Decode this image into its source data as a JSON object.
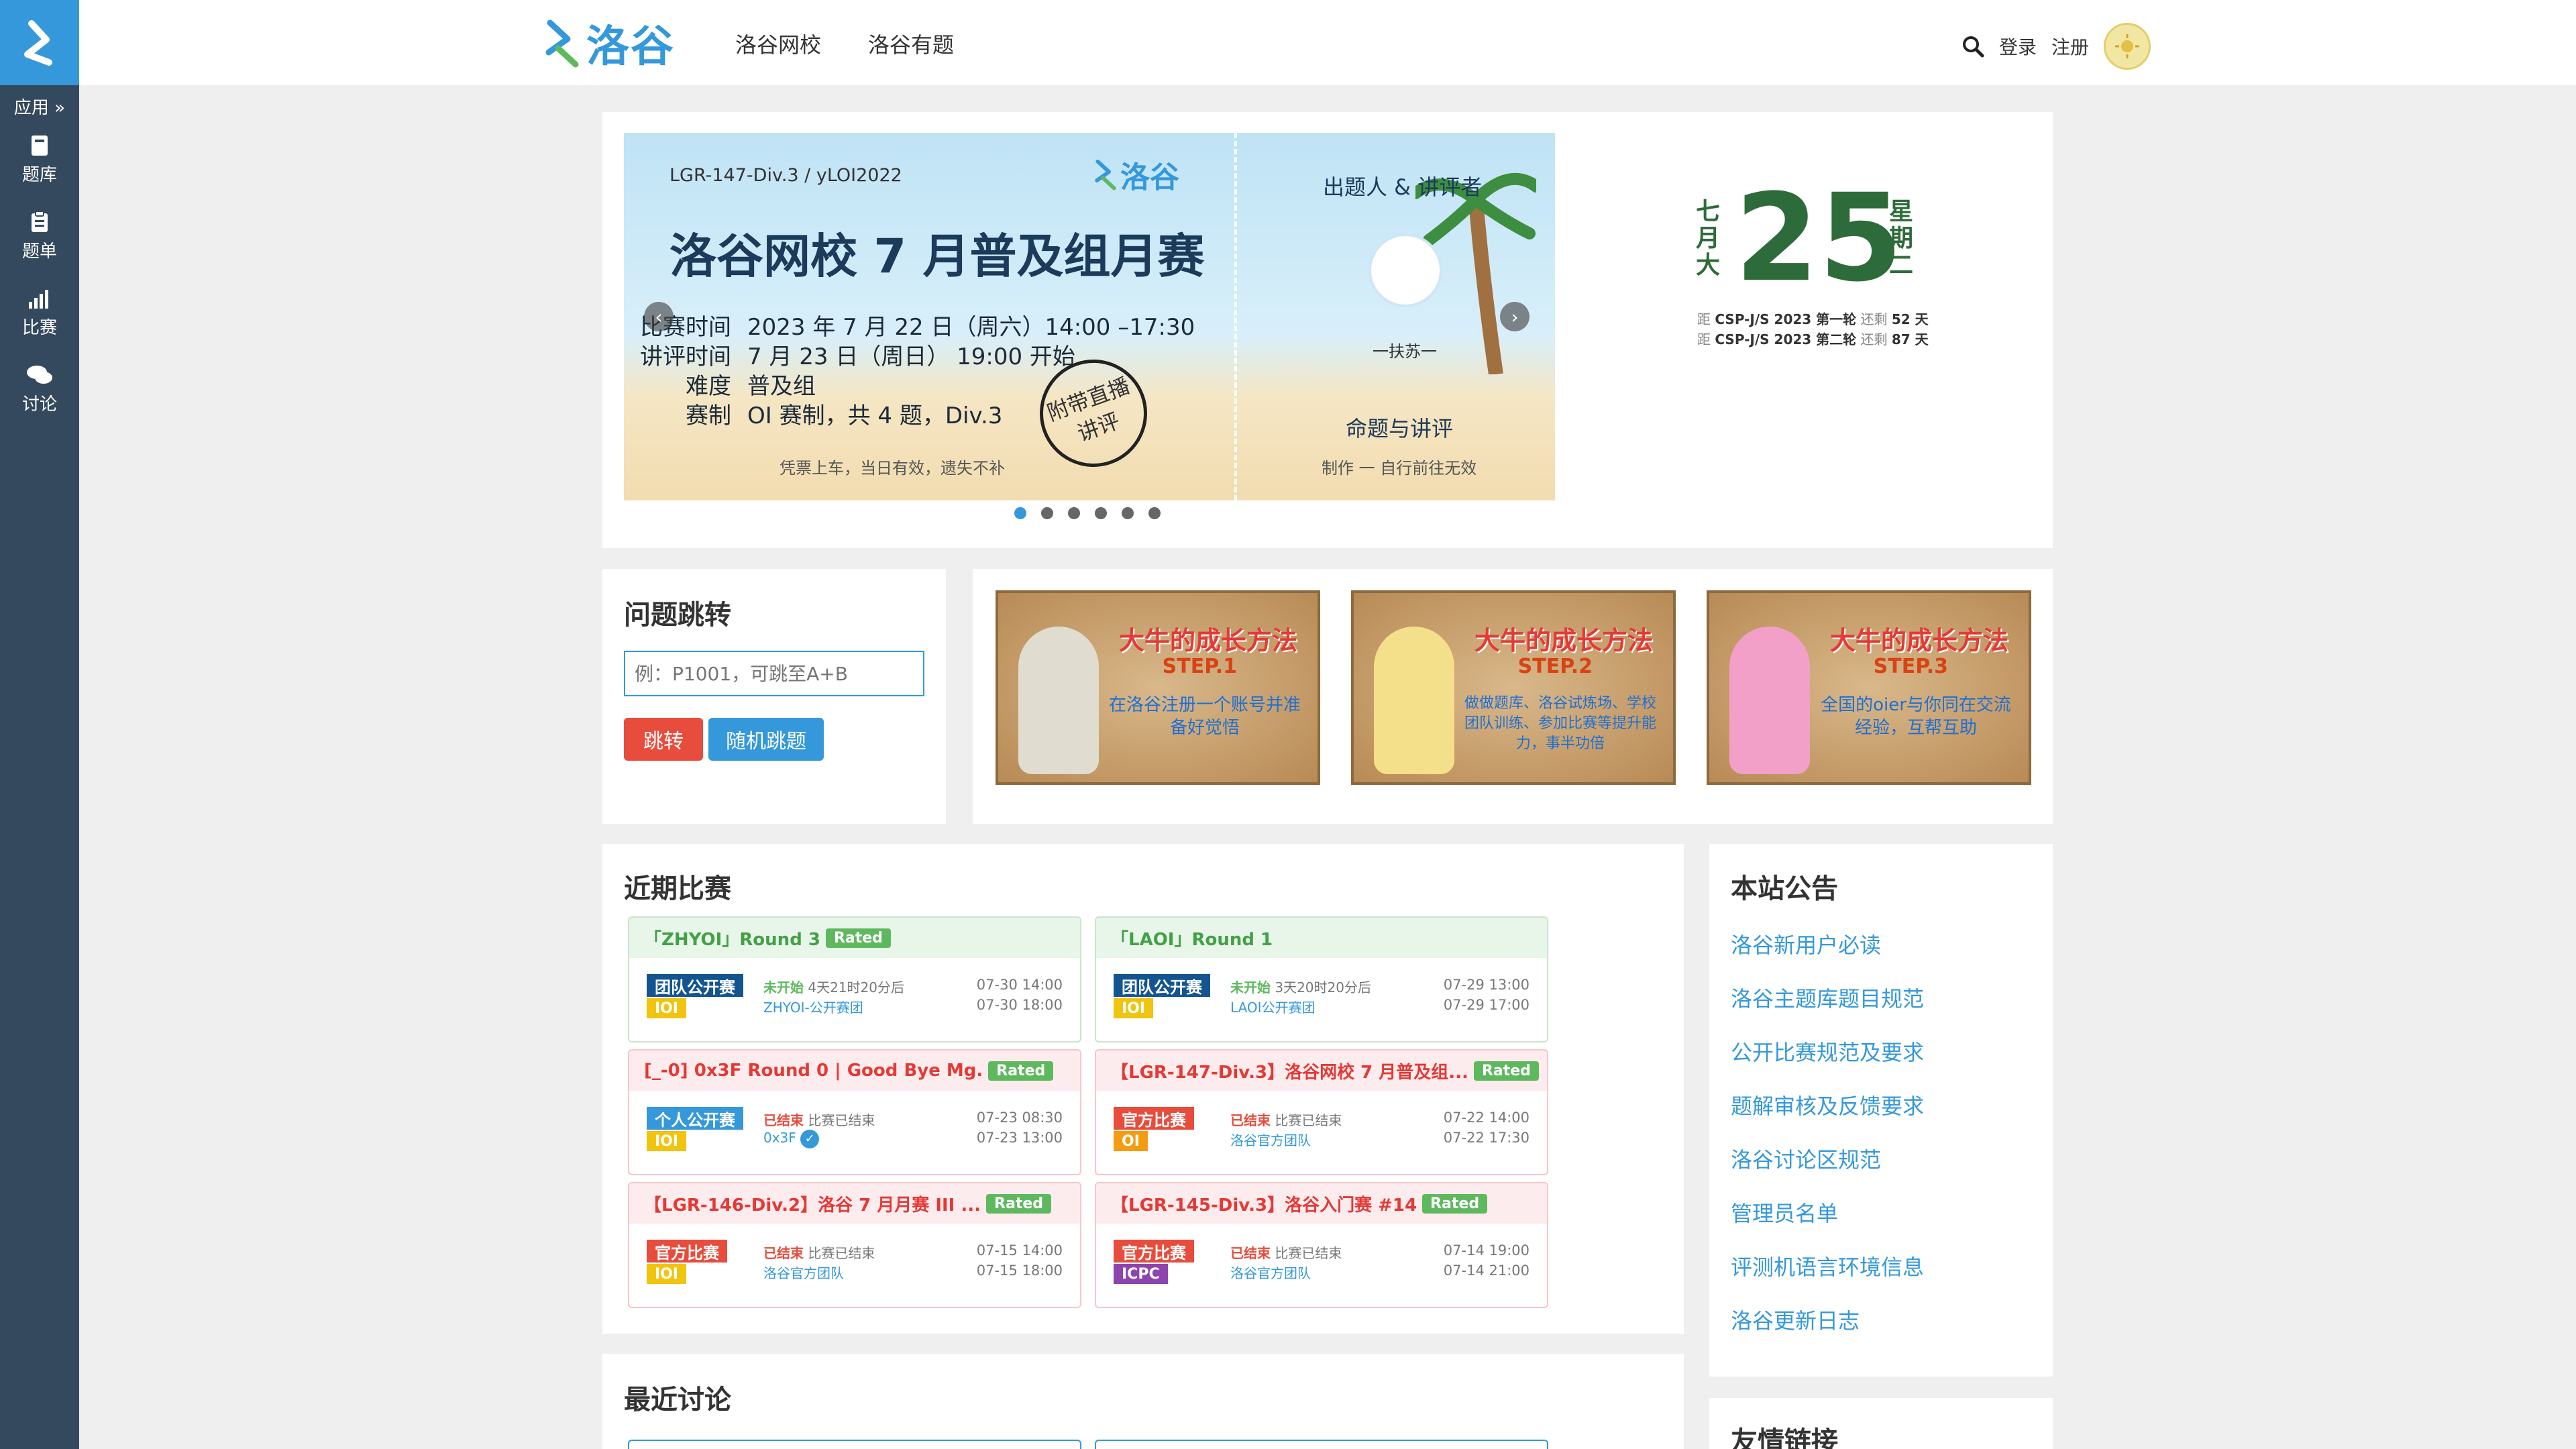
{
  "sidebar": {
    "apps_label": "应用",
    "items": [
      {
        "label": "题库",
        "icon": "book-icon"
      },
      {
        "label": "题单",
        "icon": "clipboard-icon"
      },
      {
        "label": "比赛",
        "icon": "bar-chart-icon"
      },
      {
        "label": "讨论",
        "icon": "comments-icon"
      }
    ]
  },
  "header": {
    "brand": "洛谷",
    "nav": [
      "洛谷网校",
      "洛谷有题"
    ],
    "login": "登录",
    "register": "注册"
  },
  "banner": {
    "tag": "LGR-147-Div.3 /  yLOI2022",
    "logo": "洛谷",
    "title": "洛谷网校 7 月普及组月赛",
    "rows": [
      {
        "k": "比赛时间",
        "v": "2023 年 7 月 22 日（周六）14:00 –17:30"
      },
      {
        "k": "讲评时间",
        "v": "7 月 23 日（周日） 19:00 开始"
      },
      {
        "k": "难度",
        "v": "普及组"
      },
      {
        "k": "赛制",
        "v": "OI 赛制，共 4 题，Div.3"
      }
    ],
    "stamp": "附带直播讲评",
    "footer": "凭票上车，当日有效，遗失不补",
    "right_title": "出题人 & 讲评者",
    "right_name": "一扶苏一",
    "right_sub": "命题与讲评",
    "right_footer": "制作 一  自行前往无效",
    "dot_count": 6,
    "active_dot": 0
  },
  "date": {
    "month": "七月大",
    "day": "25",
    "weekday": "星期二",
    "countdowns": [
      {
        "prefix": "距",
        "event": "CSP-J/S 2023 第一轮",
        "mid": "还剩",
        "days": "52 天"
      },
      {
        "prefix": "距",
        "event": "CSP-J/S 2023 第二轮",
        "mid": "还剩",
        "days": "87 天"
      }
    ]
  },
  "jump": {
    "title": "问题跳转",
    "placeholder": "例：P1001，可跳至A+B",
    "jump_btn": "跳转",
    "random_btn": "随机跳题"
  },
  "tutorials": [
    {
      "t1": "大牛的成长方法",
      "t2": "STEP.1",
      "t3": "在洛谷注册一个账号并准备好觉悟"
    },
    {
      "t1": "大牛的成长方法",
      "t2": "STEP.2",
      "t3": "做做题库、洛谷试炼场、学校团队训练、参加比赛等提升能力，事半功倍"
    },
    {
      "t1": "大牛的成长方法",
      "t2": "STEP.3",
      "t3": "全国的oier与你同在交流经验，互帮互助"
    }
  ],
  "contests": {
    "title": "近期比赛",
    "rated_label": "Rated",
    "items": [
      {
        "name": "「ZHYOI」Round 3",
        "rated": true,
        "type": "团队公开赛",
        "type_color": "#14558f",
        "rule": "IOI",
        "rule_color": "#f1c40f",
        "status": "未开始",
        "status_color": "#5eb95e",
        "status_text": "4天21时20分后",
        "org": "ZHYOI-公开赛团",
        "start": "07-30 14:00",
        "end": "07-30 18:00",
        "style": "green"
      },
      {
        "name": "「LAOI」Round 1",
        "rated": false,
        "type": "团队公开赛",
        "type_color": "#14558f",
        "rule": "IOI",
        "rule_color": "#f1c40f",
        "status": "未开始",
        "status_color": "#5eb95e",
        "status_text": "3天20时20分后",
        "org": "LAOI公开赛团",
        "start": "07-29 13:00",
        "end": "07-29 17:00",
        "style": "green"
      },
      {
        "name": "[_-0] 0x3F Round 0 | Good Bye Mg.",
        "rated": true,
        "type": "个人公开赛",
        "type_color": "#3498db",
        "rule": "IOI",
        "rule_color": "#f1c40f",
        "status": "已结束",
        "status_color": "#e74c3c",
        "status_text": "比赛已结束",
        "org": "0x3F",
        "start": "07-23 08:30",
        "end": "07-23 13:00",
        "style": "red"
      },
      {
        "name": "【LGR-147-Div.3】洛谷网校 7 月普及组...",
        "rated": true,
        "type": "官方比赛",
        "type_color": "#e74c3c",
        "rule": "OI",
        "rule_color": "#f39c11",
        "status": "已结束",
        "status_color": "#e74c3c",
        "status_text": "比赛已结束",
        "org": "洛谷官方团队",
        "start": "07-22 14:00",
        "end": "07-22 17:30",
        "style": "red"
      },
      {
        "name": "【LGR-146-Div.2】洛谷 7 月月赛 III ...",
        "rated": true,
        "type": "官方比赛",
        "type_color": "#e74c3c",
        "rule": "IOI",
        "rule_color": "#f1c40f",
        "status": "已结束",
        "status_color": "#e74c3c",
        "status_text": "比赛已结束",
        "org": "洛谷官方团队",
        "start": "07-15 14:00",
        "end": "07-15 18:00",
        "style": "red"
      },
      {
        "name": "【LGR-145-Div.3】洛谷入门赛 #14",
        "rated": true,
        "type": "官方比赛",
        "type_color": "#e74c3c",
        "rule": "ICPC",
        "rule_color": "#8e44ad",
        "status": "已结束",
        "status_color": "#e74c3c",
        "status_text": "比赛已结束",
        "org": "洛谷官方团队",
        "start": "07-14 19:00",
        "end": "07-14 21:00",
        "style": "red"
      }
    ]
  },
  "announcements": {
    "title": "本站公告",
    "items": [
      "洛谷新用户必读",
      "洛谷主题库题目规范",
      "公开比赛规范及要求",
      "题解审核及反馈要求",
      "洛谷讨论区规范",
      "管理员名单",
      "评测机语言环境信息",
      "洛谷更新日志"
    ]
  },
  "discussions": {
    "title": "最近讨论"
  },
  "links": {
    "title": "友情链接"
  }
}
